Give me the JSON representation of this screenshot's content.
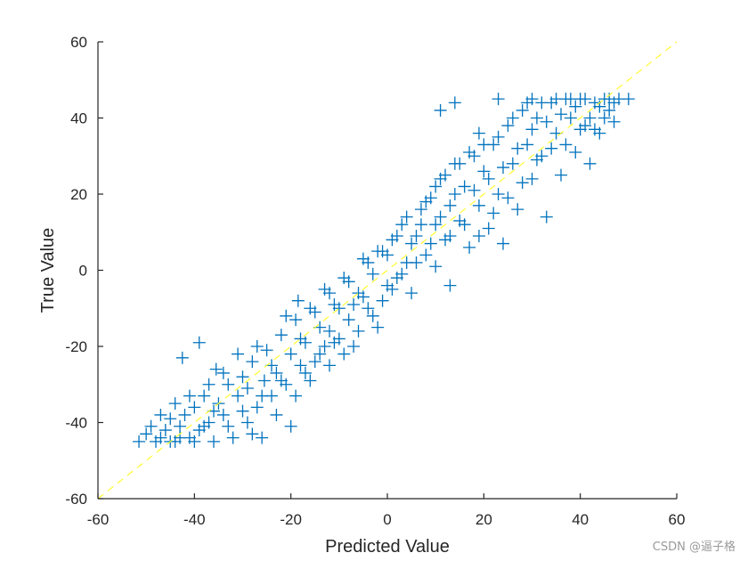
{
  "chart_data": {
    "type": "scatter",
    "title": "",
    "xlabel": "Predicted Value",
    "ylabel": "True Value",
    "xlim": [
      -60,
      60
    ],
    "ylim": [
      -60,
      60
    ],
    "xticks": [
      -60,
      -40,
      -20,
      0,
      20,
      40,
      60
    ],
    "yticks": [
      -60,
      -40,
      -20,
      0,
      20,
      40,
      60
    ],
    "xtick_labels": [
      "-60",
      "-40",
      "-20",
      "0",
      "20",
      "40",
      "60"
    ],
    "ytick_labels": [
      "-60",
      "-40",
      "-20",
      "0",
      "20",
      "40",
      "60"
    ],
    "grid": false,
    "box": false,
    "series": [
      {
        "name": "samples",
        "marker": "+",
        "color": "#0072BD",
        "points": [
          [
            -51.5,
            -45
          ],
          [
            -50,
            -43
          ],
          [
            -49,
            -41
          ],
          [
            -48,
            -45
          ],
          [
            -47,
            -44
          ],
          [
            -46,
            -42
          ],
          [
            -45,
            -39
          ],
          [
            -44,
            -45
          ],
          [
            -43,
            -41
          ],
          [
            -42.5,
            -23
          ],
          [
            -42,
            -38
          ],
          [
            -41,
            -44
          ],
          [
            -40,
            -36
          ],
          [
            -39,
            -19
          ],
          [
            -39,
            -42
          ],
          [
            -38,
            -33
          ],
          [
            -37,
            -40
          ],
          [
            -36,
            -45
          ],
          [
            -35.5,
            -26
          ],
          [
            -35,
            -35
          ],
          [
            -34,
            -38
          ],
          [
            -33,
            -30
          ],
          [
            -32,
            -44
          ],
          [
            -31,
            -33
          ],
          [
            -30,
            -28
          ],
          [
            -29,
            -40
          ],
          [
            -28,
            -24
          ],
          [
            -27,
            -36
          ],
          [
            -26,
            -44
          ],
          [
            -25.5,
            -29
          ],
          [
            -25,
            -21
          ],
          [
            -24,
            -33
          ],
          [
            -23,
            -27
          ],
          [
            -22,
            -17
          ],
          [
            -21,
            -30
          ],
          [
            -20,
            -41
          ],
          [
            -20,
            -22
          ],
          [
            -19,
            -13
          ],
          [
            -18,
            -25
          ],
          [
            -18.5,
            -8
          ],
          [
            -17,
            -19
          ],
          [
            -16,
            -29
          ],
          [
            -15,
            -11
          ],
          [
            -14,
            -22
          ],
          [
            -13,
            -5
          ],
          [
            -12,
            -16
          ],
          [
            -12,
            -25
          ],
          [
            -11,
            -9
          ],
          [
            -10,
            -18
          ],
          [
            -9,
            -2
          ],
          [
            -8,
            -13
          ],
          [
            -7,
            -20
          ],
          [
            -6,
            -6
          ],
          [
            -5,
            3
          ],
          [
            -4,
            -10
          ],
          [
            -3,
            -1
          ],
          [
            -2,
            -15
          ],
          [
            -1,
            5
          ],
          [
            0,
            -4
          ],
          [
            1,
            8
          ],
          [
            2,
            -2
          ],
          [
            3,
            12
          ],
          [
            4,
            2
          ],
          [
            5,
            -6
          ],
          [
            6,
            9
          ],
          [
            7,
            16
          ],
          [
            8,
            4
          ],
          [
            9,
            19
          ],
          [
            10,
            1
          ],
          [
            10,
            12
          ],
          [
            11,
            42
          ],
          [
            11,
            24
          ],
          [
            12,
            8
          ],
          [
            13,
            -4
          ],
          [
            13,
            17
          ],
          [
            14,
            44
          ],
          [
            14,
            28
          ],
          [
            15,
            13
          ],
          [
            16,
            22
          ],
          [
            17,
            6
          ],
          [
            18,
            30
          ],
          [
            19,
            36
          ],
          [
            19,
            17
          ],
          [
            20,
            26
          ],
          [
            21,
            11
          ],
          [
            22,
            33
          ],
          [
            23,
            45
          ],
          [
            23,
            20
          ],
          [
            24,
            7
          ],
          [
            25,
            38
          ],
          [
            26,
            28
          ],
          [
            27,
            16
          ],
          [
            28,
            42
          ],
          [
            29,
            33
          ],
          [
            30,
            45
          ],
          [
            30,
            24
          ],
          [
            31,
            40
          ],
          [
            32,
            30
          ],
          [
            33,
            14
          ],
          [
            34,
            44
          ],
          [
            35,
            36
          ],
          [
            36,
            25
          ],
          [
            37,
            45
          ],
          [
            38,
            40
          ],
          [
            39,
            31
          ],
          [
            40,
            45
          ],
          [
            41,
            38
          ],
          [
            42,
            28
          ],
          [
            43,
            44
          ],
          [
            44,
            36
          ],
          [
            45,
            45
          ],
          [
            46,
            42
          ],
          [
            47,
            39
          ],
          [
            48,
            45
          ],
          [
            50,
            45
          ],
          [
            -47,
            -38
          ],
          [
            -45,
            -45
          ],
          [
            -44,
            -35
          ],
          [
            -43,
            -44
          ],
          [
            -41,
            -33
          ],
          [
            -40,
            -45
          ],
          [
            -38,
            -41
          ],
          [
            -37,
            -30
          ],
          [
            -36,
            -37
          ],
          [
            -34,
            -27
          ],
          [
            -33,
            -41
          ],
          [
            -31,
            -22
          ],
          [
            -30,
            -37
          ],
          [
            -29,
            -31
          ],
          [
            -28,
            -43
          ],
          [
            -27,
            -20
          ],
          [
            -26,
            -33
          ],
          [
            -24,
            -25
          ],
          [
            -23,
            -38
          ],
          [
            -22,
            -29
          ],
          [
            -21,
            -12
          ],
          [
            -19,
            -33
          ],
          [
            -18,
            -18
          ],
          [
            -17,
            -27
          ],
          [
            -16,
            -10
          ],
          [
            -15,
            -24
          ],
          [
            -14,
            -15
          ],
          [
            -13,
            -20
          ],
          [
            -12,
            -6
          ],
          [
            -11,
            -19
          ],
          [
            -10,
            -10
          ],
          [
            -9,
            -22
          ],
          [
            -8,
            -3
          ],
          [
            -7,
            -9
          ],
          [
            -6,
            -16
          ],
          [
            -5,
            -7
          ],
          [
            -4,
            2
          ],
          [
            -3,
            -12
          ],
          [
            -2,
            5
          ],
          [
            -1,
            -8
          ],
          [
            0,
            4
          ],
          [
            1,
            -5
          ],
          [
            2,
            9
          ],
          [
            3,
            -1
          ],
          [
            4,
            14
          ],
          [
            5,
            7
          ],
          [
            6,
            2
          ],
          [
            7,
            12
          ],
          [
            8,
            18
          ],
          [
            9,
            7
          ],
          [
            10,
            22
          ],
          [
            11,
            14
          ],
          [
            12,
            25
          ],
          [
            13,
            9
          ],
          [
            14,
            20
          ],
          [
            15,
            28
          ],
          [
            16,
            12
          ],
          [
            17,
            31
          ],
          [
            18,
            21
          ],
          [
            19,
            9
          ],
          [
            20,
            33
          ],
          [
            21,
            24
          ],
          [
            22,
            15
          ],
          [
            23,
            35
          ],
          [
            24,
            27
          ],
          [
            25,
            19
          ],
          [
            26,
            40
          ],
          [
            27,
            32
          ],
          [
            28,
            23
          ],
          [
            29,
            44
          ],
          [
            30,
            37
          ],
          [
            31,
            29
          ],
          [
            32,
            44
          ],
          [
            33,
            39
          ],
          [
            34,
            32
          ],
          [
            35,
            45
          ],
          [
            36,
            41
          ],
          [
            37,
            33
          ],
          [
            38,
            45
          ],
          [
            39,
            43
          ],
          [
            40,
            37
          ],
          [
            41,
            45
          ],
          [
            42,
            40
          ],
          [
            43,
            37
          ],
          [
            44,
            43
          ],
          [
            45,
            40
          ],
          [
            46,
            45
          ],
          [
            47,
            44
          ]
        ]
      }
    ],
    "reference_line": {
      "type": "identity",
      "style": "dashed",
      "color": "#FFFF33",
      "from": [
        -60,
        -60
      ],
      "to": [
        60,
        60
      ]
    }
  },
  "watermark": "CSDN @逼子格"
}
